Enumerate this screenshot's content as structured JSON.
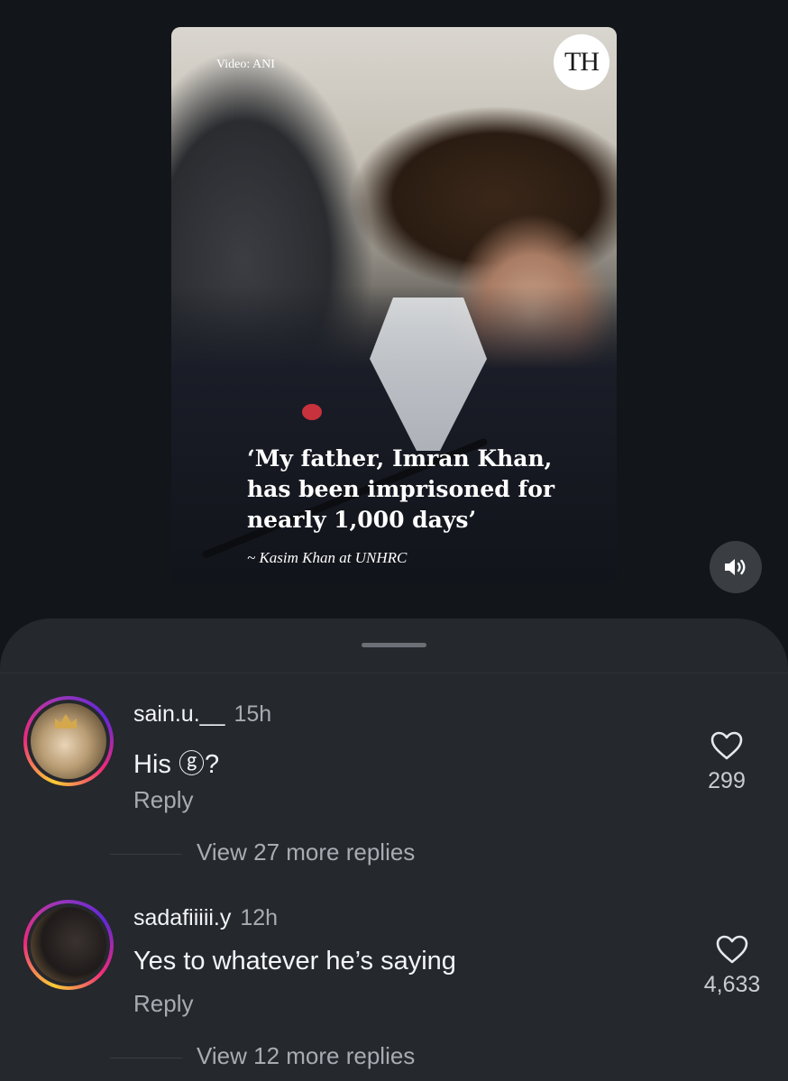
{
  "video": {
    "credit": "Video: ANI",
    "logo": "TH",
    "quote": "‘My father, Imran Khan, has been imprisoned for nearly 1,000 days’",
    "attribution": "~ Kasim Khan at UNHRC",
    "sound_icon": "speaker-volume-icon"
  },
  "comments": [
    {
      "username": "sain.u.__",
      "time": "15h",
      "text": "His ⓖ?",
      "reply_label": "Reply",
      "likes": "299",
      "view_replies": "View 27 more replies"
    },
    {
      "username": "sadafiiiii.y",
      "time": "12h",
      "text": "Yes to whatever he’s saying",
      "reply_label": "Reply",
      "likes": "4,633",
      "view_replies": "View 12 more replies"
    }
  ],
  "colors": {
    "background": "#121519",
    "sheet": "#25282d",
    "secondary_text": "#a8acb2"
  }
}
